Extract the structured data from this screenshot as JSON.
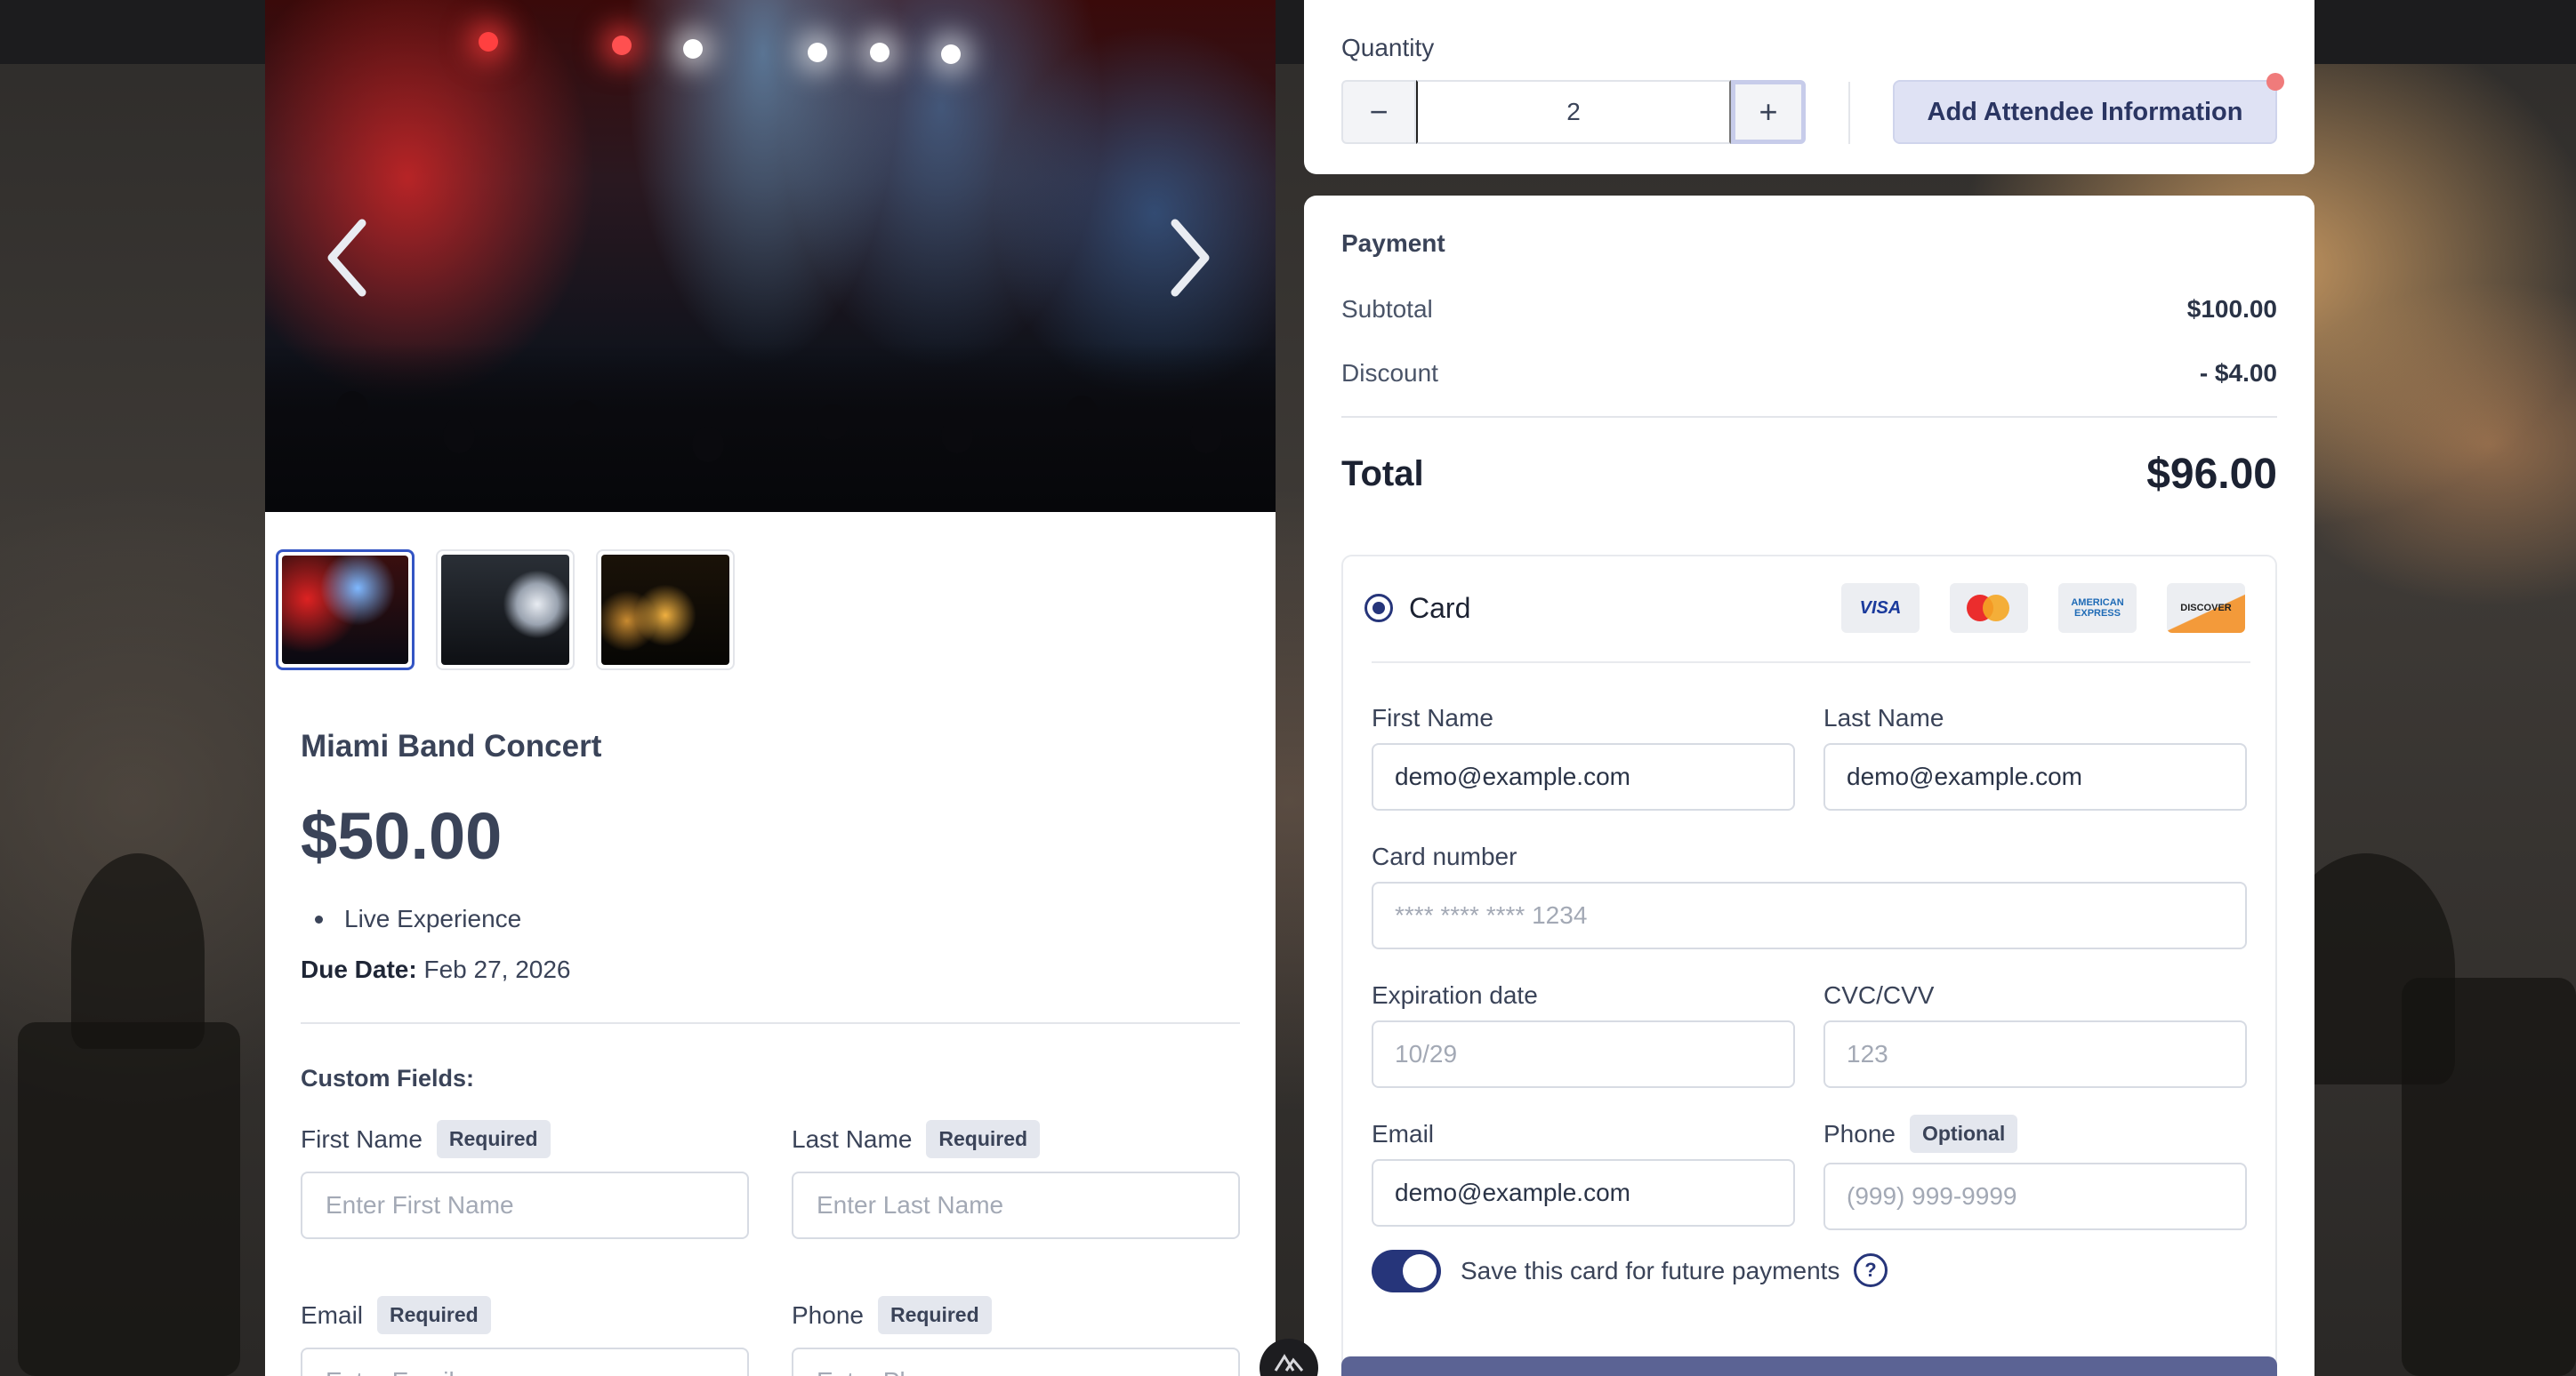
{
  "gallery": {
    "prev_label": "Previous image",
    "next_label": "Next image",
    "thumbnails": [
      "Concert stage thumbnail",
      "Crowd with screen thumbnail",
      "Warm lights thumbnail"
    ]
  },
  "event": {
    "title": "Miami Band Concert",
    "price": "$50.00",
    "features": [
      "Live Experience"
    ],
    "due_label": "Due Date:",
    "due_date": "Feb 27, 2026"
  },
  "custom_fields": {
    "title": "Custom Fields:",
    "first_name": {
      "label": "First Name",
      "badge": "Required",
      "placeholder": "Enter First Name"
    },
    "last_name": {
      "label": "Last Name",
      "badge": "Required",
      "placeholder": "Enter Last Name"
    },
    "email": {
      "label": "Email",
      "badge": "Required",
      "placeholder": "Enter Email"
    },
    "phone": {
      "label": "Phone",
      "badge": "Required",
      "placeholder": "Enter Phone"
    }
  },
  "quantity": {
    "label": "Quantity",
    "value": "2",
    "minus": "−",
    "plus": "+",
    "attendee_button": "Add Attendee Information"
  },
  "payment": {
    "title": "Payment",
    "subtotal_label": "Subtotal",
    "subtotal_value": "$100.00",
    "discount_label": "Discount",
    "discount_value": "- $4.00",
    "total_label": "Total",
    "total_value": "$96.00",
    "method_label": "Card",
    "brands": {
      "visa": "VISA",
      "amex": "AMERICAN EXPRESS",
      "discover": "DISCOVER"
    },
    "first_name_label": "First Name",
    "first_name_value": "demo@example.com",
    "last_name_label": "Last Name",
    "last_name_value": "demo@example.com",
    "card_number_label": "Card number",
    "card_number_placeholder": "**** **** **** 1234",
    "expiration_label": "Expiration date",
    "expiration_placeholder": "10/29",
    "cvc_label": "CVC/CVV",
    "cvc_placeholder": "123",
    "email_label": "Email",
    "email_value": "demo@example.com",
    "phone_label": "Phone",
    "phone_badge": "Optional",
    "phone_placeholder": "(999) 999-9999",
    "save_card_label": "Save this card for future payments",
    "save_card_enabled": true,
    "help_symbol": "?"
  },
  "colors": {
    "accent": "#26357a",
    "button_bg": "#dfe2f4",
    "notification": "#f07b7b"
  }
}
